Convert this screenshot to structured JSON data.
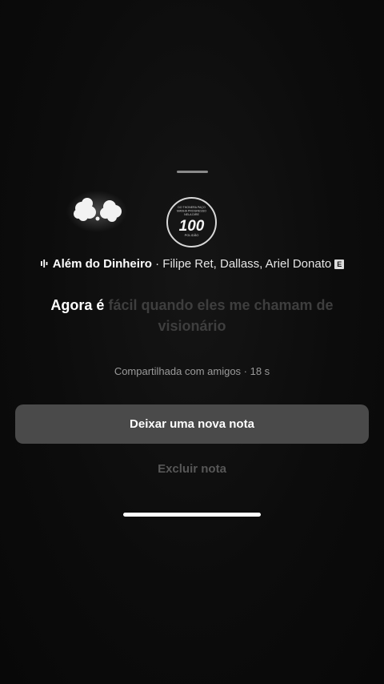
{
  "note": {
    "emoji_icon": "exploding-head-emoji",
    "song": {
      "icon": "audio-bars-icon",
      "title": "Além do Dinheiro",
      "separator": " · ",
      "artists": "Filipe Ret, Dallass, Ariel Donato",
      "explicit_badge": "E"
    },
    "album_art": {
      "line1": "DO THONERA PAÇO",
      "line2": "MANHA PROGRESSO",
      "line3": "NELA DIRE",
      "number": "100",
      "caption": "POLIDÃO"
    },
    "lyric": {
      "sung": "Agora é",
      "unsung": " fácil quando eles me chamam de visionário"
    },
    "shared_info": "Compartilhada com amigos · 18 s"
  },
  "actions": {
    "new_note_label": "Deixar uma nova nota",
    "delete_note_label": "Excluir nota"
  },
  "colors": {
    "background": "#0b0b0b",
    "button": "#4a4a4a",
    "unsung_lyric": "#3e3e3e",
    "secondary_text": "#9a9a9a"
  }
}
